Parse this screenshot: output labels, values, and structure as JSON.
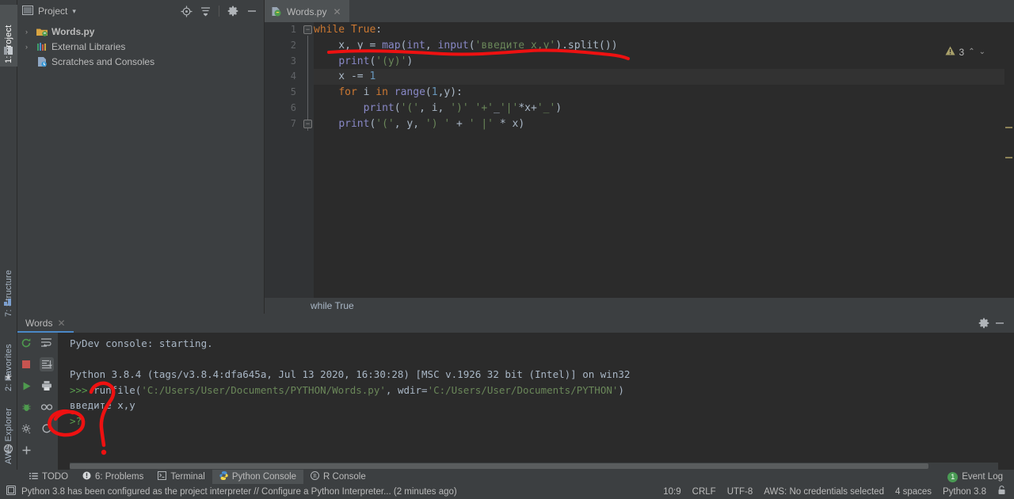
{
  "left_strip": {
    "tabs": [
      {
        "label": "1: Project",
        "glyph": "▉",
        "active": true
      },
      {
        "label": "7: Structure",
        "glyph": "▦",
        "active": false
      },
      {
        "label": "2: Favorites",
        "glyph": "★",
        "active": false
      },
      {
        "label": "AWS Explorer",
        "glyph": "✪",
        "active": false
      }
    ]
  },
  "project_panel": {
    "title": "Project",
    "dropdown_caret": "▾",
    "icons": [
      "locate-target-icon",
      "collapse-all-icon",
      "settings-gear-icon",
      "hide-panel-icon"
    ],
    "tree": [
      {
        "label": "Words.py",
        "arrow": "›",
        "icon": "python-module-icon",
        "bold": true
      },
      {
        "label": "External Libraries",
        "arrow": "›",
        "icon": "libraries-icon",
        "bold": false
      },
      {
        "label": "Scratches and Consoles",
        "arrow": "",
        "icon": "scratches-icon",
        "bold": false
      }
    ]
  },
  "editor": {
    "tab": {
      "label": "Words.py",
      "icon": "python-file-icon",
      "close": "✕"
    },
    "warnings": {
      "icon": "warning-triangle-icon",
      "count": "3",
      "up": "⌃",
      "down": "⌄"
    },
    "line_numbers": [
      "1",
      "2",
      "3",
      "4",
      "5",
      "6",
      "7"
    ],
    "current_line": 4,
    "breadcrumb": "while True",
    "lines": [
      [
        {
          "t": "while",
          "c": "kw"
        },
        {
          "t": " ",
          "c": "pl"
        },
        {
          "t": "True",
          "c": "kw"
        },
        {
          "t": ":",
          "c": "pl"
        }
      ],
      [
        {
          "t": "    x, y = ",
          "c": "pl"
        },
        {
          "t": "map",
          "c": "bi"
        },
        {
          "t": "(",
          "c": "pl"
        },
        {
          "t": "int",
          "c": "bi"
        },
        {
          "t": ", ",
          "c": "pl"
        },
        {
          "t": "input",
          "c": "bi"
        },
        {
          "t": "(",
          "c": "pl"
        },
        {
          "t": "'введите x,y'",
          "c": "str"
        },
        {
          "t": ").split())",
          "c": "pl"
        }
      ],
      [
        {
          "t": "    ",
          "c": "pl"
        },
        {
          "t": "print",
          "c": "bi"
        },
        {
          "t": "(",
          "c": "pl"
        },
        {
          "t": "'(y)'",
          "c": "str"
        },
        {
          "t": ")",
          "c": "pl"
        }
      ],
      [
        {
          "t": "    x -= ",
          "c": "pl"
        },
        {
          "t": "1",
          "c": "num"
        }
      ],
      [
        {
          "t": "    ",
          "c": "pl"
        },
        {
          "t": "for",
          "c": "kw"
        },
        {
          "t": " i ",
          "c": "pl"
        },
        {
          "t": "in",
          "c": "kw"
        },
        {
          "t": " ",
          "c": "pl"
        },
        {
          "t": "range",
          "c": "bi"
        },
        {
          "t": "(",
          "c": "pl"
        },
        {
          "t": "1",
          "c": "num"
        },
        {
          "t": ",y):",
          "c": "pl"
        }
      ],
      [
        {
          "t": "        ",
          "c": "pl"
        },
        {
          "t": "print",
          "c": "bi"
        },
        {
          "t": "(",
          "c": "pl"
        },
        {
          "t": "'('",
          "c": "str"
        },
        {
          "t": ", i, ",
          "c": "pl"
        },
        {
          "t": "')'",
          "c": "str"
        },
        {
          "t": " ",
          "c": "pl"
        },
        {
          "t": "'+'",
          "c": "str"
        },
        {
          "t": "_",
          "c": "pl"
        },
        {
          "t": "'|'",
          "c": "str"
        },
        {
          "t": "*x+",
          "c": "pl"
        },
        {
          "t": "'_'",
          "c": "str"
        },
        {
          "t": ")",
          "c": "pl"
        }
      ],
      [
        {
          "t": "    ",
          "c": "pl"
        },
        {
          "t": "print",
          "c": "bi"
        },
        {
          "t": "(",
          "c": "pl"
        },
        {
          "t": "'('",
          "c": "str"
        },
        {
          "t": ", y, ",
          "c": "pl"
        },
        {
          "t": "') '",
          "c": "str"
        },
        {
          "t": " + ",
          "c": "pl"
        },
        {
          "t": "' |'",
          "c": "str"
        },
        {
          "t": " * x)",
          "c": "pl"
        }
      ]
    ]
  },
  "console": {
    "tab": {
      "label": "Words",
      "close": "✕"
    },
    "header_icons": [
      "settings-gear-icon",
      "hide-panel-icon"
    ],
    "toolbar_left": [
      "rerun-icon",
      "stop-icon",
      "run-icon",
      "debug-icon",
      "settings-icon",
      "add-icon"
    ],
    "toolbar_right": [
      "soft-wrap-icon",
      "scroll-to-end-icon",
      "print-icon",
      "link-icon",
      "history-icon"
    ],
    "output": [
      {
        "text": "PyDev console: starting.",
        "cls": "pl"
      },
      {
        "text": "",
        "cls": "pl"
      },
      {
        "text": "Python 3.8.4 (tags/v3.8.4:dfa645a, Jul 13 2020, 16:30:28) [MSC v.1926 32 bit (Intel)] on win32",
        "cls": "pl"
      }
    ],
    "runline": {
      "prompt": ">>> ",
      "pre": "runfile(",
      "path1": "'C:/Users/User/Documents/PYTHON/Words.py'",
      "mid": ", wdir=",
      "path2": "'C:/Users/User/Documents/PYTHON'",
      "post": ")"
    },
    "input_echo": "введите x,y",
    "result_line": ">?"
  },
  "toolwindow_bar": {
    "items": [
      {
        "label": "TODO",
        "icon": "todo-icon",
        "active": false
      },
      {
        "label": "6: Problems",
        "icon": "problems-icon",
        "active": false
      },
      {
        "label": "Terminal",
        "icon": "terminal-icon",
        "active": false
      },
      {
        "label": "Python Console",
        "icon": "python-console-icon",
        "active": true
      },
      {
        "label": "R Console",
        "icon": "r-console-icon",
        "active": false
      }
    ],
    "event_log": {
      "label": "Event Log",
      "count": "1"
    }
  },
  "statusbar": {
    "icon": "info-icon",
    "message": "Python 3.8 has been configured as the project interpreter // Configure a Python Interpreter... (2 minutes ago)",
    "caret": "10:9",
    "line_sep": "CRLF",
    "encoding": "UTF-8",
    "aws": "AWS: No credentials selected",
    "indent": "4 spaces",
    "interpreter": "Python 3.8",
    "lock_icon": "lock-icon"
  },
  "annotations": {
    "color": "#ee1111",
    "marks": [
      "underline-stroke-line2",
      "circle-around-prompt",
      "question-mark-scribble"
    ]
  }
}
